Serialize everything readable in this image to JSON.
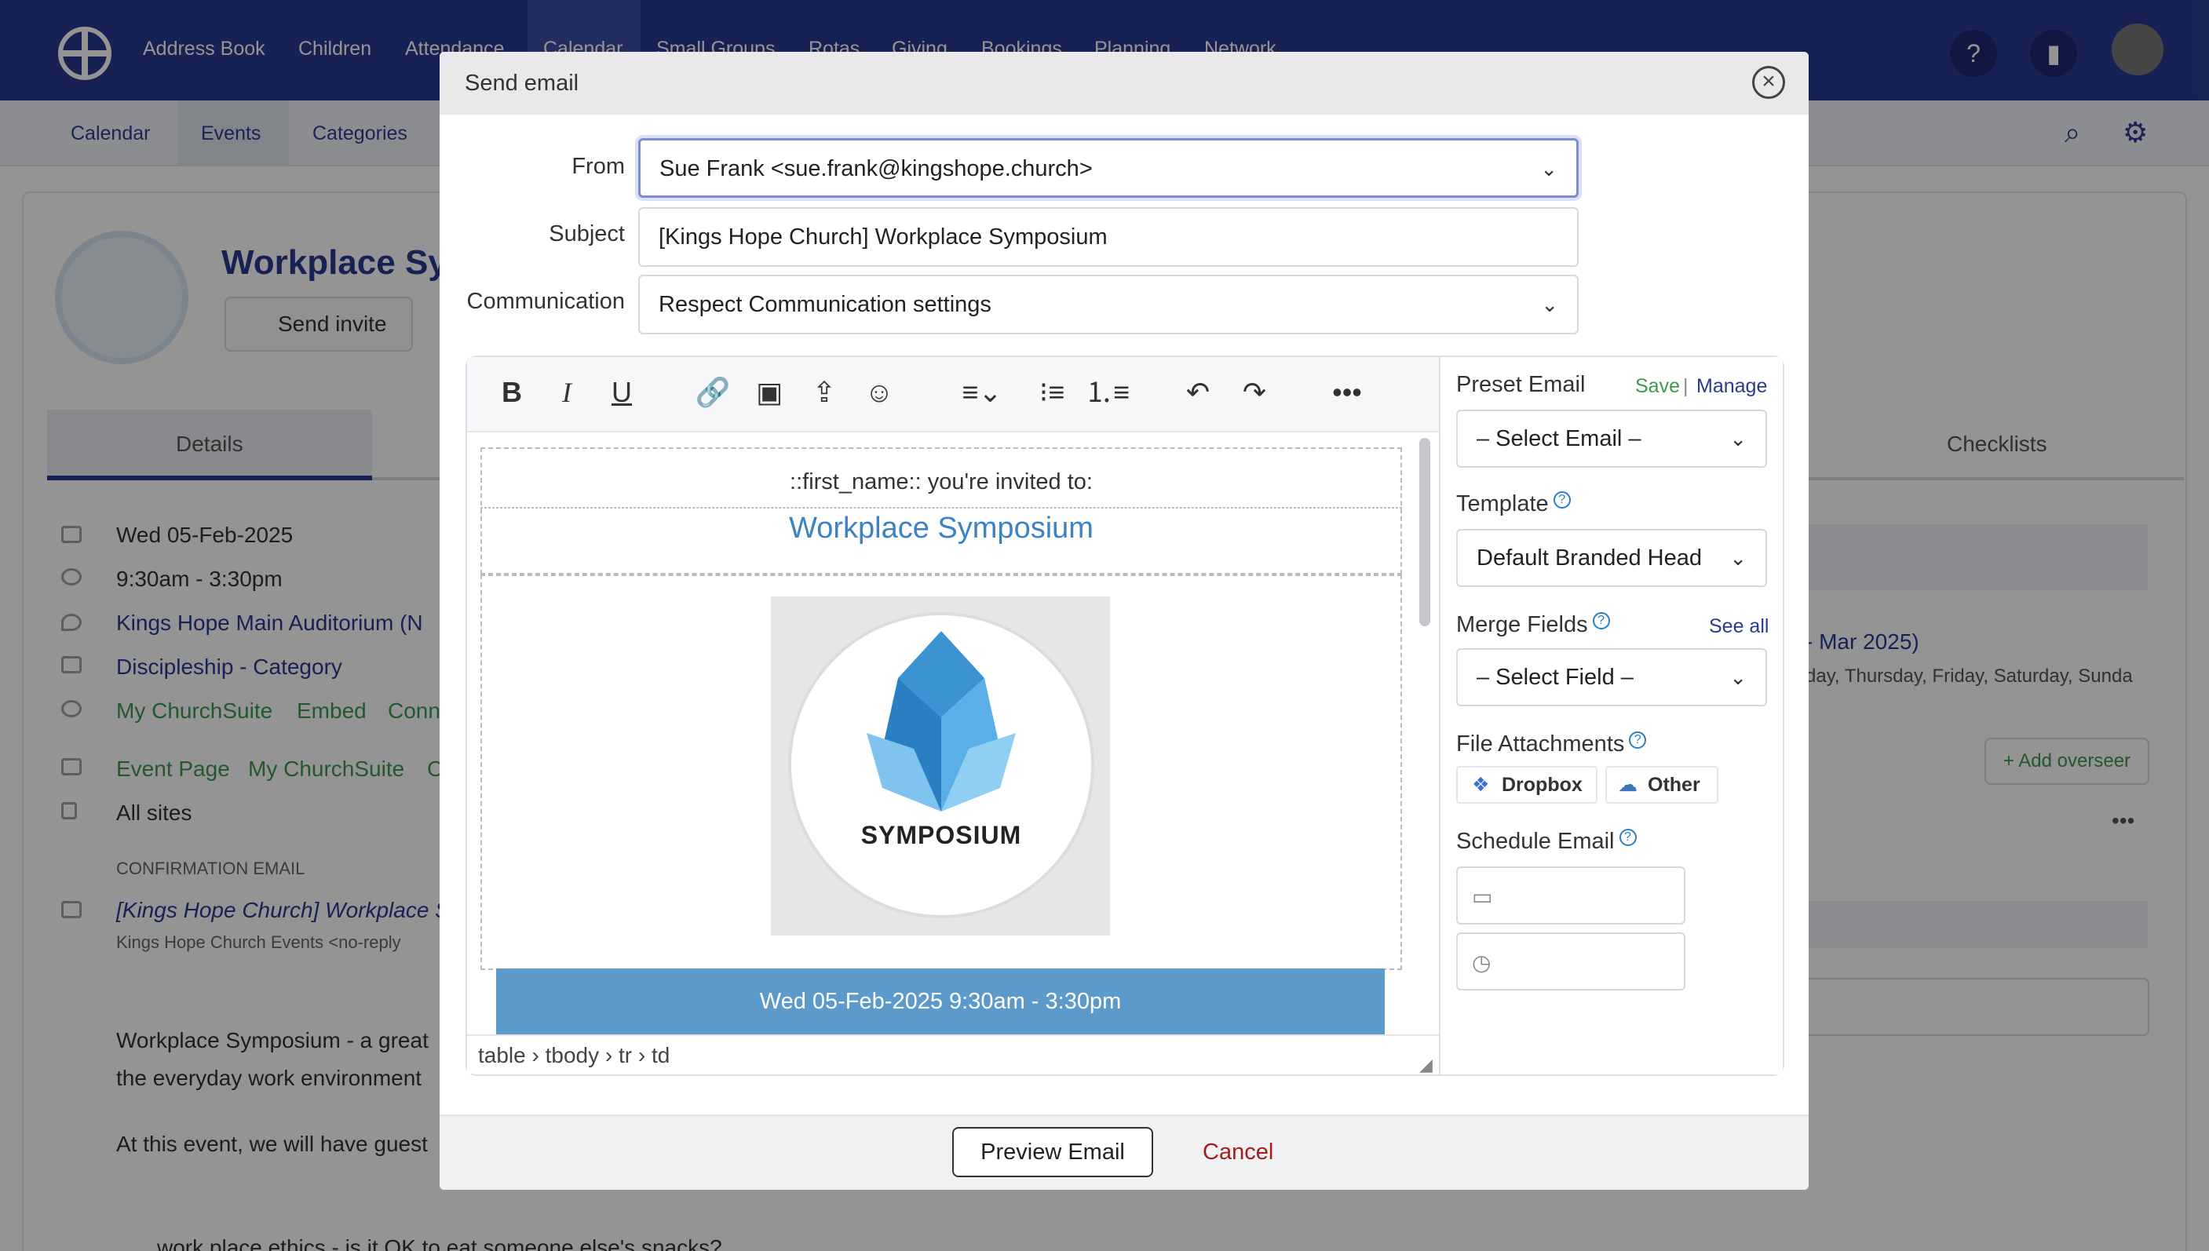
{
  "app": {
    "nav": [
      "Address Book",
      "Children",
      "Attendance",
      "Calendar",
      "Small Groups",
      "Rotas",
      "Giving",
      "Bookings",
      "Planning",
      "Network"
    ],
    "subnav": [
      "Calendar",
      "Events",
      "Categories"
    ],
    "event": {
      "title": "Workplace Symposium",
      "send_invite": "Send invite",
      "tab_details": "Details",
      "tab_checklists": "Checklists",
      "date": "Wed 05-Feb-2025",
      "time": "9:30am - 3:30pm",
      "location": "Kings Hope Main Auditorium (N",
      "category": "Discipleship - Category",
      "visibility": [
        "My ChurchSuite",
        "Embed",
        "Conn"
      ],
      "page_links": [
        "Event Page",
        "My ChurchSuite",
        "C"
      ],
      "sites": "All sites",
      "confirmation_heading": "CONFIRMATION EMAIL",
      "confirmation_subject": "[Kings Hope Church] Workplace Sy",
      "confirmation_from": "Kings Hope Church Events  <no-reply",
      "description_1": "Workplace Symposium - a great",
      "description_2": "the everyday work environment",
      "description_3": "At this event, we will have guest",
      "bullet": "work place ethics - is it OK to eat someone else's snacks?",
      "recurrence_range": "- Mar 2025)",
      "recurrence_days": "day, Thursday, Friday, Saturday, Sunda",
      "add_overseer": "+ Add overseer"
    }
  },
  "modal": {
    "title": "Send email",
    "from_label": "From",
    "from_value": "Sue Frank <sue.frank@kingshope.church>",
    "subject_label": "Subject",
    "subject_value": "[Kings Hope Church] Workplace Symposium",
    "communication_label": "Communication",
    "communication_value": "Respect Communication settings",
    "editor": {
      "invite_line": "::first_name:: you're invited to:",
      "event_name": "Workplace Symposium",
      "image_caption": "SYMPOSIUM",
      "date_band": "Wed 05-Feb-2025 9:30am - 3:30pm",
      "status_path": "table › tbody › tr › td"
    },
    "panel": {
      "preset_label": "Preset Email",
      "save": "Save",
      "separator": "|",
      "manage": "Manage",
      "preset_value": "– Select Email –",
      "template_label": "Template",
      "template_value": "Default Branded Head",
      "merge_label": "Merge Fields",
      "see_all": "See all",
      "merge_value": "– Select Field –",
      "attachments_label": "File Attachments",
      "dropbox": "Dropbox",
      "other": "Other",
      "schedule_label": "Schedule Email"
    },
    "preview_button": "Preview Email",
    "cancel_button": "Cancel"
  },
  "colors": {
    "nav": "#2a3a8f",
    "link": "#3b83c3",
    "green": "#3a9a4e",
    "cancel": "#a51c1c"
  }
}
